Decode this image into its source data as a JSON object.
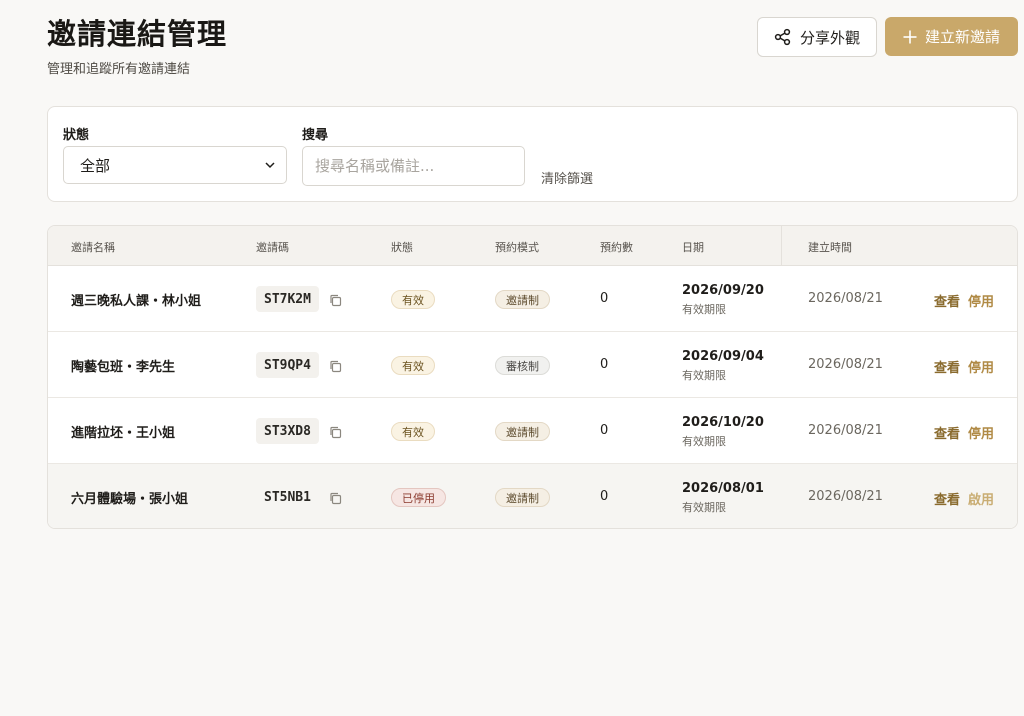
{
  "header": {
    "title": "邀請連結管理",
    "subtitle": "管理和追蹤所有邀請連結"
  },
  "toolbar": {
    "share_label": "分享外觀",
    "new_label": "建立新邀請"
  },
  "filters": {
    "status_label": "狀態",
    "status_value": "全部",
    "search_label": "搜尋",
    "search_placeholder": "搜尋名稱或備註...",
    "clear_label": "清除篩選"
  },
  "table": {
    "headers": {
      "name": "邀請名稱",
      "code": "邀請碼",
      "status": "狀態",
      "mode": "預約模式",
      "count": "預約數",
      "date": "日期",
      "created": "建立時間"
    },
    "rows": [
      {
        "name": "週三晚私人課・林小姐",
        "code": "ST7K2M",
        "status": "有效",
        "mode": "邀請制",
        "count": "0",
        "date": "2026/09/20",
        "date_note": "有效期限",
        "created": "2026/08/21",
        "view": "查看",
        "toggle": "停用"
      },
      {
        "name": "陶藝包班・李先生",
        "code": "ST9QP4",
        "status": "有效",
        "mode": "審核制",
        "count": "0",
        "date": "2026/09/04",
        "date_note": "有效期限",
        "created": "2026/08/21",
        "view": "查看",
        "toggle": "停用"
      },
      {
        "name": "進階拉坯・王小姐",
        "code": "ST3XD8",
        "status": "有效",
        "mode": "邀請制",
        "count": "0",
        "date": "2026/10/20",
        "date_note": "有效期限",
        "created": "2026/08/21",
        "view": "查看",
        "toggle": "停用"
      },
      {
        "name": "六月體驗場・張小姐",
        "code": "ST5NB1",
        "status": "已停用",
        "mode": "邀請制",
        "count": "0",
        "date": "2026/08/01",
        "date_note": "有效期限",
        "created": "2026/08/21",
        "view": "查看",
        "toggle": "啟用"
      }
    ]
  },
  "colors": {
    "accent": "#c9a86a",
    "background": "#f9f8f6",
    "active_badge": "#faf3e3",
    "stopped_badge": "#f6e6e3"
  },
  "icons": {
    "share": "share-icon",
    "new": "plus-icon",
    "select": "chevron-down-icon",
    "copy": "copy-icon"
  }
}
